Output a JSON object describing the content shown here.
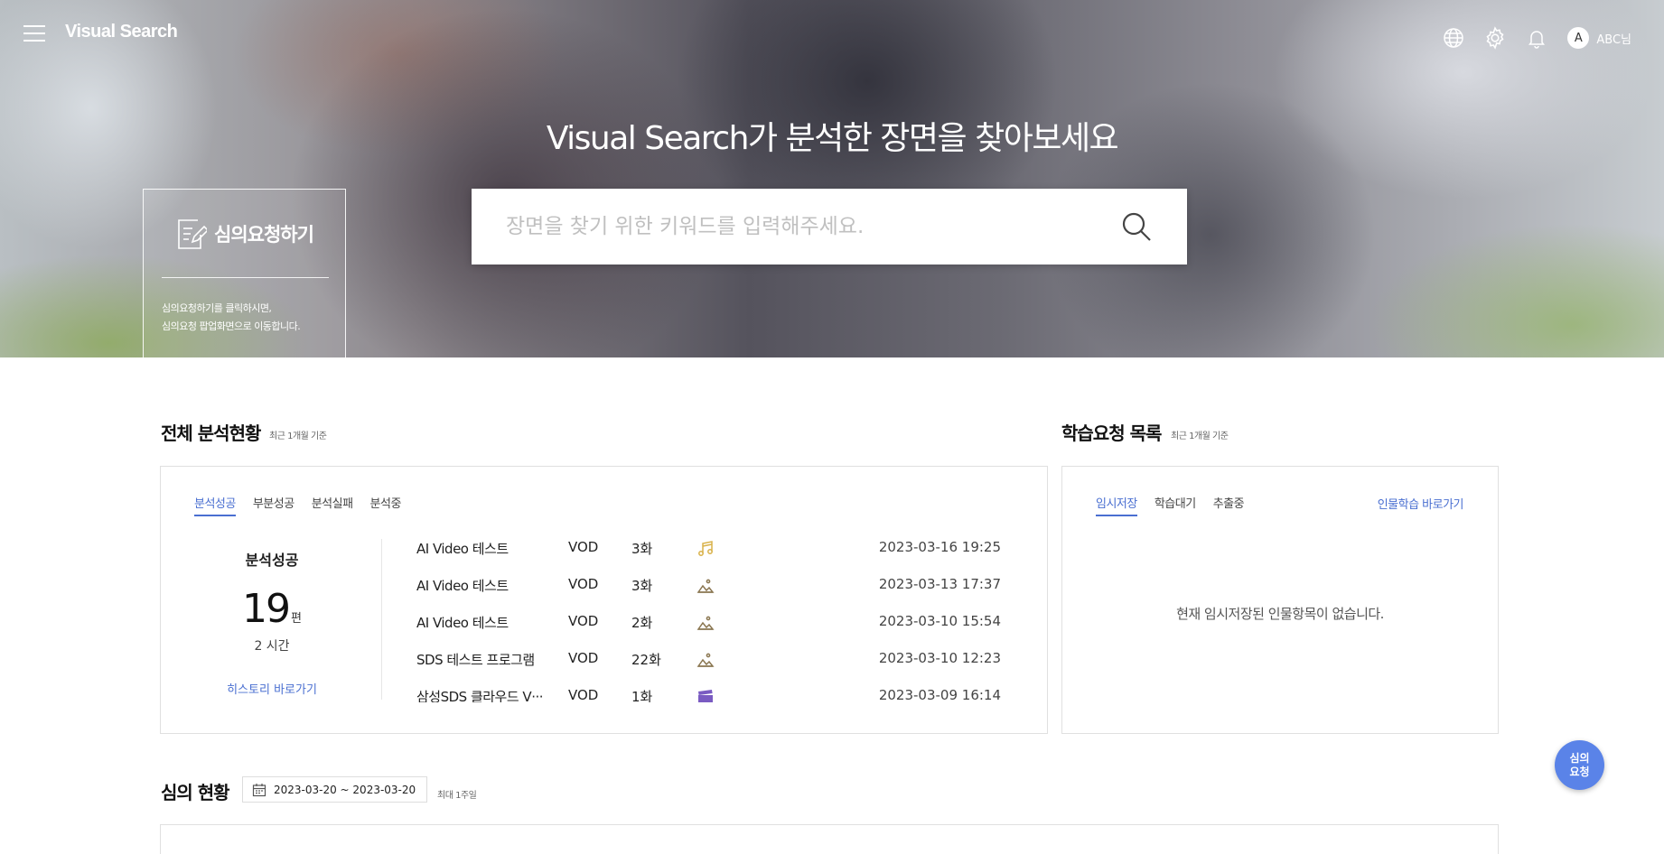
{
  "header": {
    "logo": "Visual Search",
    "user_initial": "A",
    "user_name": "ABC님",
    "icons": [
      "menu-icon",
      "globe-icon",
      "gear-icon",
      "bell-icon"
    ]
  },
  "hero": {
    "title": "Visual Search가 분석한 장면을 찾아보세요",
    "search_placeholder": "장면을 찾기 위한 키워드를 입력해주세요.",
    "search_value": ""
  },
  "request_card": {
    "title": "심의요청하기",
    "desc_line1": "심의요청하기를 클릭하시면,",
    "desc_line2": "심의요청 팝업화면으로 이동합니다."
  },
  "analysis": {
    "title": "전체 분석현황",
    "subtitle": "최근 1개월 기준",
    "tabs": [
      "분석성공",
      "부분성공",
      "분석실패",
      "분석중"
    ],
    "active_tab": 0,
    "summary": {
      "label": "분석성공",
      "count": "19",
      "unit": "편",
      "time": "2 시간",
      "history_link": "히스토리 바로가기"
    },
    "rows": [
      {
        "title": "AI Video 테스트",
        "type": "VOD",
        "episode": "3화",
        "icon": "music-icon",
        "date": "2023-03-16 19:25"
      },
      {
        "title": "AI Video 테스트",
        "type": "VOD",
        "episode": "3화",
        "icon": "image-icon",
        "date": "2023-03-13 17:37"
      },
      {
        "title": "AI Video 테스트",
        "type": "VOD",
        "episode": "2화",
        "icon": "image-icon",
        "date": "2023-03-10 15:54"
      },
      {
        "title": "SDS 테스트 프로그램",
        "type": "VOD",
        "episode": "22화",
        "icon": "image-icon",
        "date": "2023-03-10 12:23"
      },
      {
        "title": "삼성SDS 클라우드 V···",
        "type": "VOD",
        "episode": "1화",
        "icon": "clapper-icon",
        "date": "2023-03-09 16:14"
      }
    ],
    "colors": {
      "music": "#d9b24a",
      "image": "#8a7650",
      "clapper": "#7a5bc2"
    }
  },
  "learning": {
    "title": "학습요청 목록",
    "subtitle": "최근 1개월 기준",
    "tabs": [
      "임시저장",
      "학습대기",
      "추출중"
    ],
    "active_tab": 0,
    "link": "인물학습 바로가기",
    "empty_message": "현재 임시저장된 인물항목이 없습니다."
  },
  "review": {
    "title": "심의 현황",
    "date_range": "2023-03-20 ~ 2023-03-20",
    "note": "최대 1주일"
  },
  "fab": {
    "line1": "심의",
    "line2": "요청"
  },
  "theme": {
    "accent": "#4a6fd1",
    "fab": "#5a83e8"
  }
}
